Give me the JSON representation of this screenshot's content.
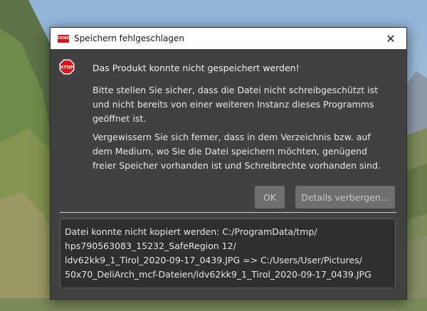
{
  "dialog": {
    "title": "Speichern fehlgeschlagen",
    "app_icon_label": "CEWE",
    "close_glyph": "✕",
    "heading": "Das Produkt konnte nicht gespeichert werden!",
    "paragraph1": "Bitte stellen Sie sicher, dass die Datei nicht schreibgeschützt ist und nicht bereits von einer weiteren Instanz dieses Programms geöffnet ist.",
    "paragraph2": "Vergewissern Sie sich ferner, dass in dem Verzeichnis bzw. auf dem Medium, wo Sie die Datei speichern möchten, genügend freier Speicher vorhanden ist und Schreibrechte vorhanden sind.",
    "stop_icon_text": "STOP",
    "buttons": {
      "ok": "OK",
      "details": "Details verbergen..."
    },
    "details_lines": [
      "Datei konnte nicht kopiert werden: C:/ProgramData/tmp/",
      "hps790563083_15232_SafeRegion 12/",
      "ldv62kk9_1_Tirol_2020-09-17_0439.JPG => C:/Users/User/Pictures/",
      "50x70_DeliArch_mcf-Dateien/ldv62kk9_1_Tirol_2020-09-17_0439.JPG"
    ]
  },
  "colors": {
    "dialog_bg": "#414141",
    "stop_red": "#d4161c",
    "button_bg": "#6e6e6e"
  }
}
